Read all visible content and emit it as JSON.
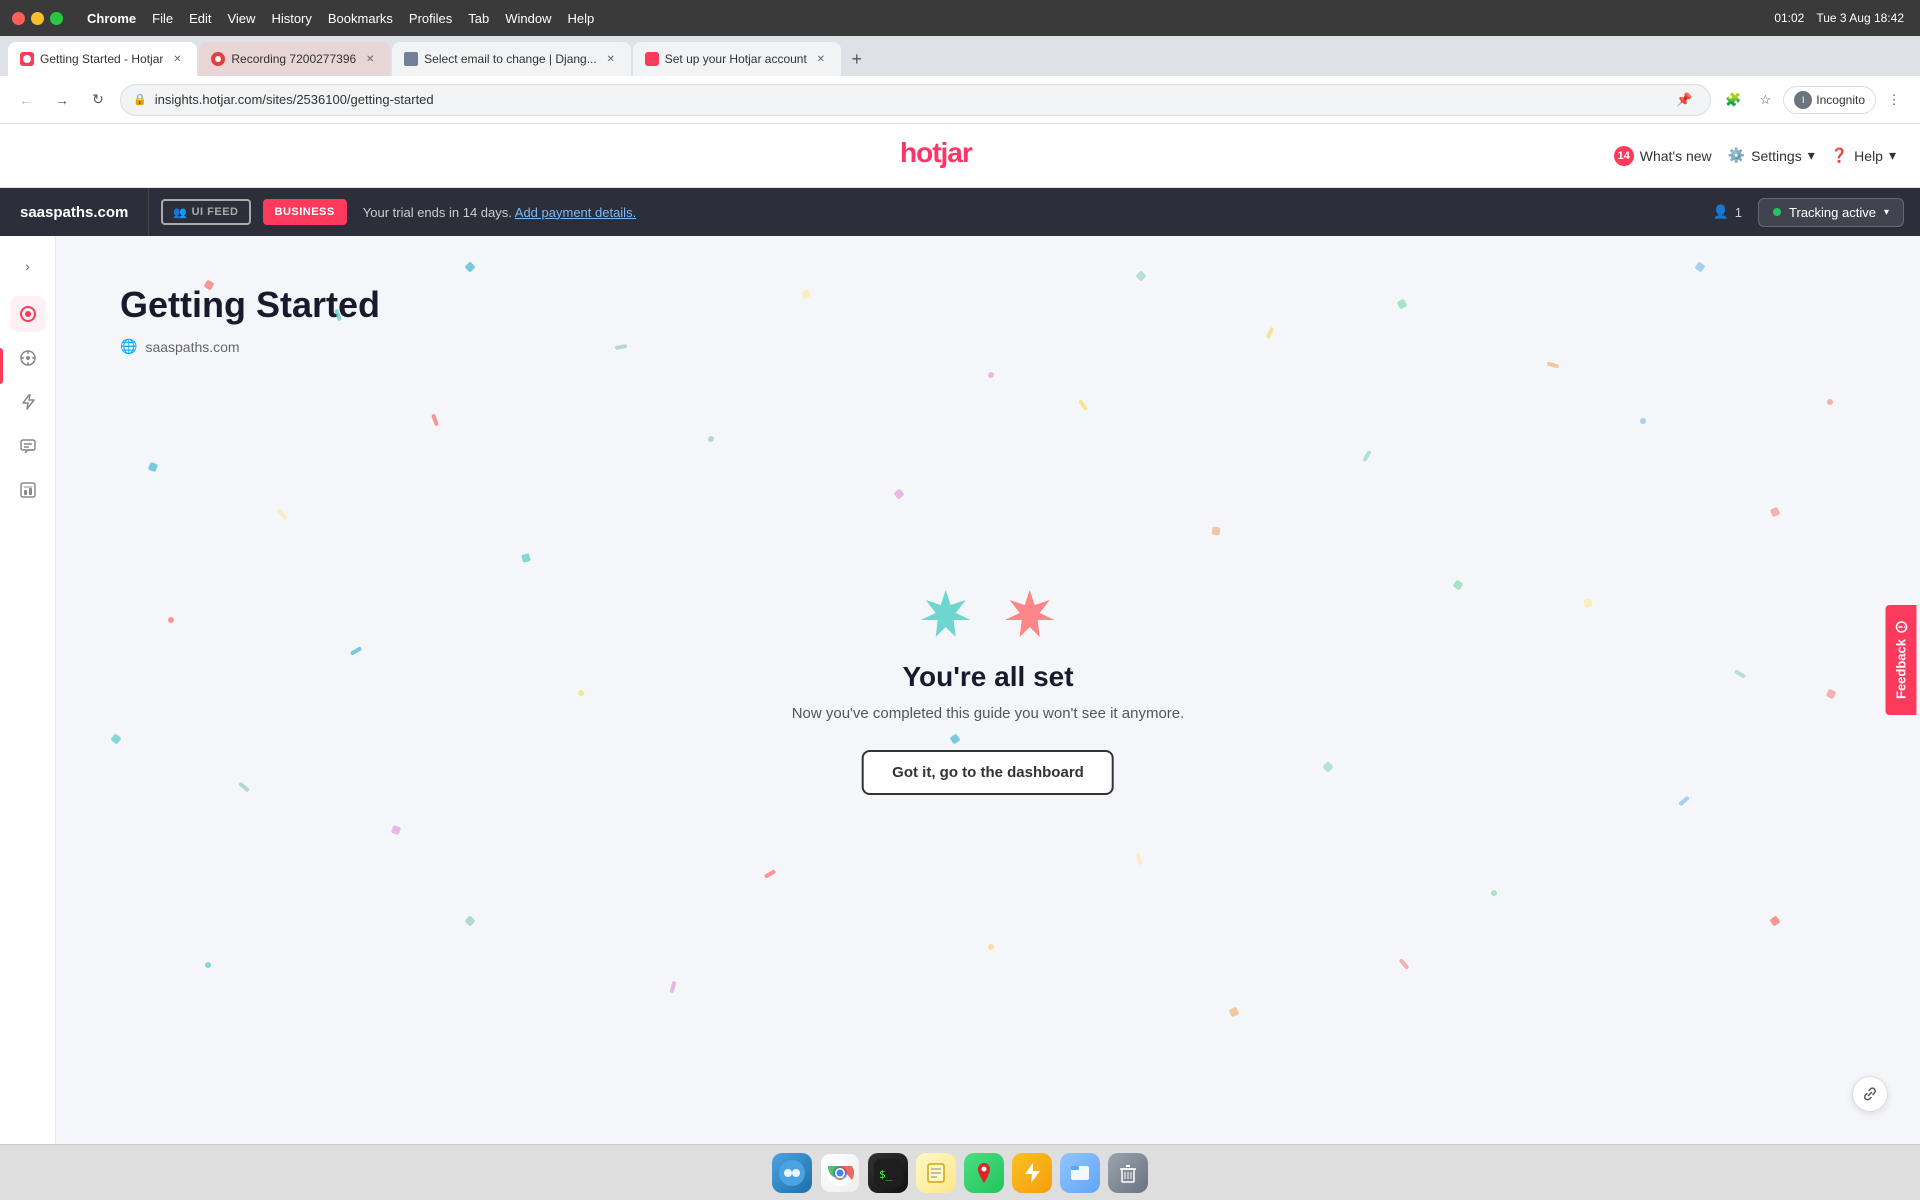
{
  "os": {
    "time": "Tue 3 Aug  18:42",
    "battery": "01:02"
  },
  "chrome": {
    "menu_items": [
      "Chrome",
      "File",
      "Edit",
      "View",
      "History",
      "Bookmarks",
      "Profiles",
      "Tab",
      "Window",
      "Help"
    ],
    "tabs": [
      {
        "id": "tab1",
        "title": "Getting Started - Hotjar",
        "active": true,
        "favicon_color": "#fd3a5c"
      },
      {
        "id": "tab2",
        "title": "Recording 7200277396",
        "active": false,
        "favicon_color": "#e53e3e"
      },
      {
        "id": "tab3",
        "title": "Select email to change | Djang...",
        "active": false,
        "favicon_color": "#718096"
      },
      {
        "id": "tab4",
        "title": "Set up your Hotjar account",
        "active": false,
        "favicon_color": "#fd3a5c"
      }
    ],
    "address": "insights.hotjar.com/sites/2536100/getting-started",
    "profile": "Incognito"
  },
  "hotjar_nav": {
    "logo": "hotjar",
    "whats_new_label": "What's new",
    "whats_new_count": "14",
    "settings_label": "Settings",
    "help_label": "Help"
  },
  "site_bar": {
    "site_name": "saaspaths.com",
    "ui_feed_label": "UI FEED",
    "business_label": "BUSINESS",
    "trial_text": "Your trial ends in 14 days.",
    "add_payment_link": "Add payment details.",
    "users_count": "1",
    "tracking_active_label": "Tracking active"
  },
  "sidebar": {
    "items": [
      {
        "id": "toggle",
        "icon": "›",
        "label": "Toggle sidebar"
      },
      {
        "id": "heatmaps",
        "icon": "🔥",
        "label": "Heatmaps",
        "active": true
      },
      {
        "id": "recordings",
        "icon": "⏱",
        "label": "Recordings"
      },
      {
        "id": "events",
        "icon": "⚡",
        "label": "Events"
      },
      {
        "id": "feedback",
        "icon": "📋",
        "label": "Feedback"
      },
      {
        "id": "surveys",
        "icon": "📊",
        "label": "Surveys"
      }
    ]
  },
  "page": {
    "title": "Getting Started",
    "subtitle_icon": "🌐",
    "subtitle_text": "saaspaths.com"
  },
  "main_card": {
    "heading": "You're all set",
    "description": "Now you've completed this guide you won't see it anymore.",
    "button_label": "Got it, go to the dashboard"
  },
  "feedback_tab": {
    "label": "Feedback"
  },
  "dock": {
    "items": [
      "finder",
      "chrome",
      "terminal",
      "notes",
      "maps",
      "lightning",
      "files",
      "trash"
    ]
  }
}
